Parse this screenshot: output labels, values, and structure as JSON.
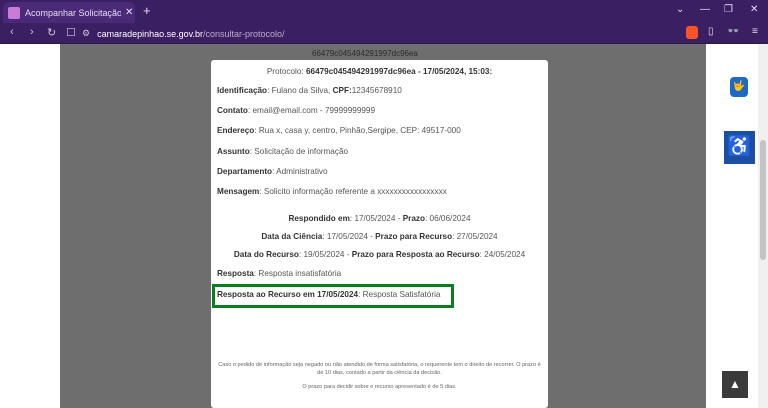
{
  "browser": {
    "tab_title": "Acompanhar Solicitação – Câm",
    "tab_close": "✕",
    "new_tab": "+",
    "url_domain": "camaradepinhao.se.gov.br",
    "url_path": "/consultar-protocolo/",
    "nav": {
      "back": "‹",
      "forward": "›",
      "reload": "↻",
      "bookmark": "☐"
    },
    "window": {
      "caret": "⌄",
      "minimize": "—",
      "restore": "❐",
      "close": "✕"
    },
    "toolbar_icons": {
      "sidebar": "▯",
      "glasses": "👓",
      "menu": "≡"
    }
  },
  "page": {
    "behind_text": "66479c045494291997dc96ea",
    "protocol_line": {
      "label": "Protocolo: ",
      "value": "66479c045494291997dc96ea - 17/05/2024, 15:03:"
    },
    "fields": [
      {
        "label": "Identificação",
        "value": ": Fulano da Silva, ",
        "label2": "CPF:",
        "value2": "12345678910"
      },
      {
        "label": "Contato",
        "value": ": email@email.com - 79999999999"
      },
      {
        "label": "Endereço",
        "value": ": Rua x, casa y, centro, Pinhão,Sergipe, CEP: 49517-000"
      },
      {
        "label": "Assunto",
        "value": ": Solicitação de informação"
      },
      {
        "label": "Departamento",
        "value": ": Administrativo"
      },
      {
        "label": "Mensagem",
        "value": ": Solicito informação referente a xxxxxxxxxxxxxxxxx"
      }
    ],
    "dates": [
      {
        "l1": "Respondido em",
        "v1": ": 17/05/2024 - ",
        "l2": "Prazo",
        "v2": ": 06/06/2024"
      },
      {
        "l1": "Data da Ciência",
        "v1": ":  17/05/2024 - ",
        "l2": "Prazo para Recurso",
        "v2": ": 27/05/2024"
      },
      {
        "l1": "Data do Recurso",
        "v1": ": 19/05/2024 - ",
        "l2": "Prazo para Resposta ao Recurso",
        "v2": ": 24/05/2024"
      }
    ],
    "resposta": {
      "label": "Resposta",
      "value": ": Resposta insatisfatória"
    },
    "resposta_recurso": {
      "label": "Resposta ao Recurso em 17/05/2024",
      "value": ": Resposta Satisfatória"
    },
    "fine_print": {
      "p1": "Caso o pedido de informação seja negado ou não atendido de forma satisfatória, o requerente tem o direito de recorrer. O prazo é de 10 dias, contado a partir da ciência da decisão.",
      "p2": "O prazo para decidir sobre o recurso apresentado é de 5 dias."
    },
    "widgets": {
      "vlibras": "🤟",
      "accessibility": "♿",
      "back_to_top": "▲"
    }
  },
  "colors": {
    "highlight_border": "#0a7d22",
    "overlay": "#6e6e6e",
    "accessibility_blue": "#1c4fa3"
  }
}
